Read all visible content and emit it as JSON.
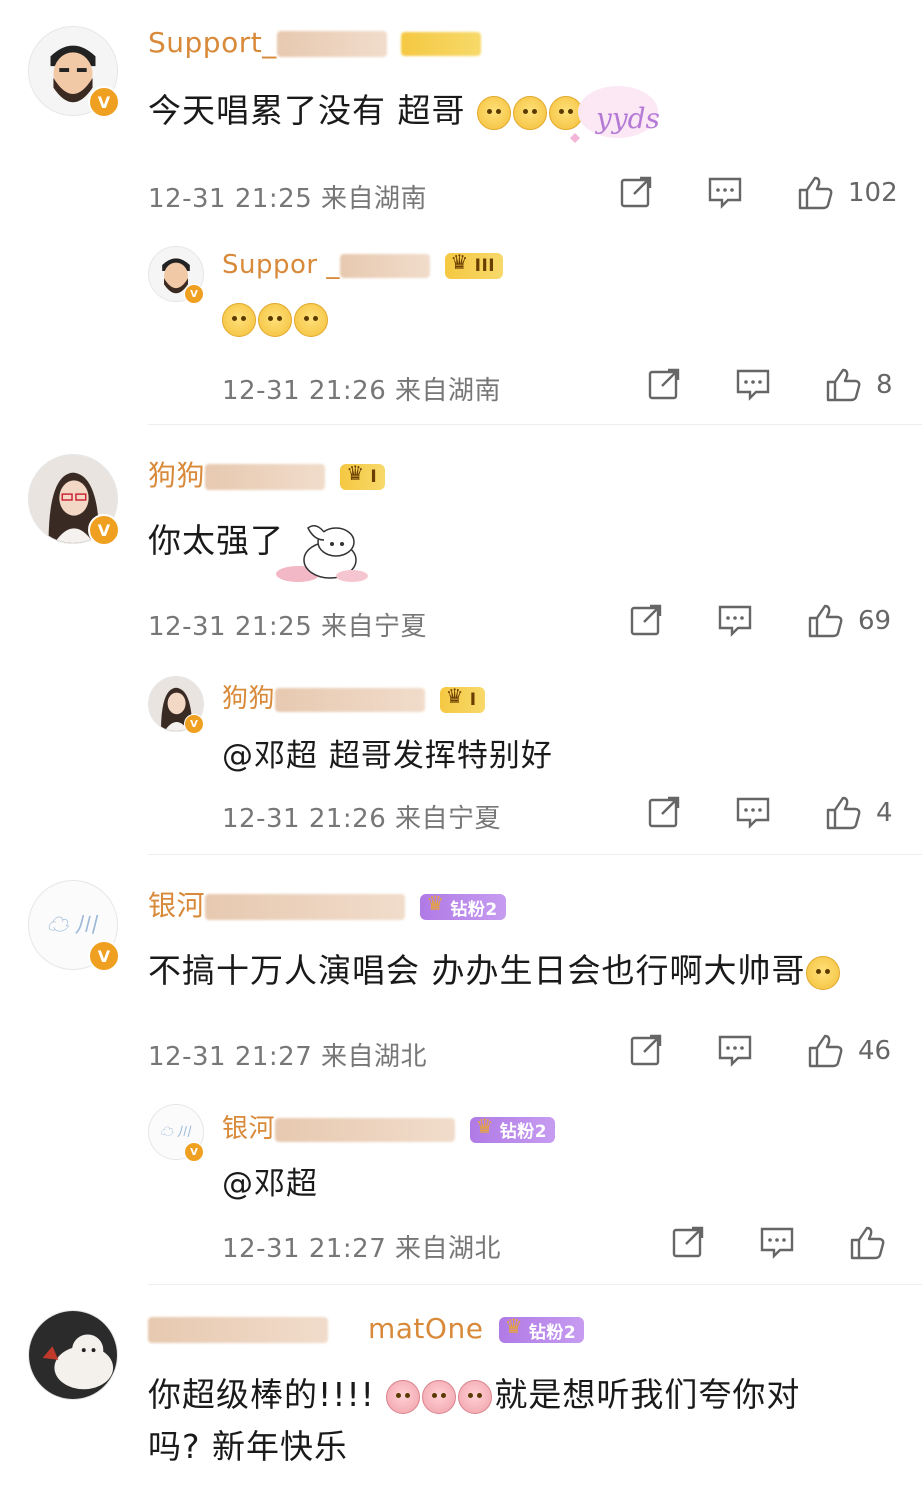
{
  "comments": [
    {
      "name": "Support_",
      "text": "今天唱累了没有 超哥",
      "time": "12-31 21:25",
      "location": "来自湖南",
      "likes": "102",
      "reply": {
        "name": "Suppor _",
        "badge": "III",
        "text": "",
        "time": "12-31 21:26",
        "location": "来自湖南",
        "likes": "8"
      }
    },
    {
      "name": "狗狗",
      "badge": "I",
      "text": "你太强了",
      "time": "12-31 21:25",
      "location": "来自宁夏",
      "likes": "69",
      "reply": {
        "name": "狗狗",
        "badge": "I",
        "text": "@邓超  超哥发挥特别好",
        "time": "12-31 21:26",
        "location": "来自宁夏",
        "likes": "4"
      }
    },
    {
      "name": "银河",
      "badge": "钻粉2",
      "text": "不搞十万人演唱会 办办生日会也行啊大帅哥",
      "time": "12-31 21:27",
      "location": "来自湖北",
      "likes": "46",
      "reply": {
        "name": "银河",
        "badge": "钻粉2",
        "text": "@邓超",
        "time": "12-31 21:27",
        "location": "来自湖北",
        "likes": ""
      }
    },
    {
      "name": "matOne",
      "badge": "钻粉2",
      "text_line1": "你超级棒的!!!!",
      "text_line1b": "就是想听我们夸你对",
      "text_line2": "吗? 新年快乐"
    }
  ],
  "avatar_badge": "V",
  "sticker_text": "yyds",
  "icons": [
    "share-icon",
    "comment-icon",
    "like-icon"
  ],
  "colors": {
    "name": "#d88a3a",
    "verified": "#f0a020",
    "meta": "#777777"
  }
}
